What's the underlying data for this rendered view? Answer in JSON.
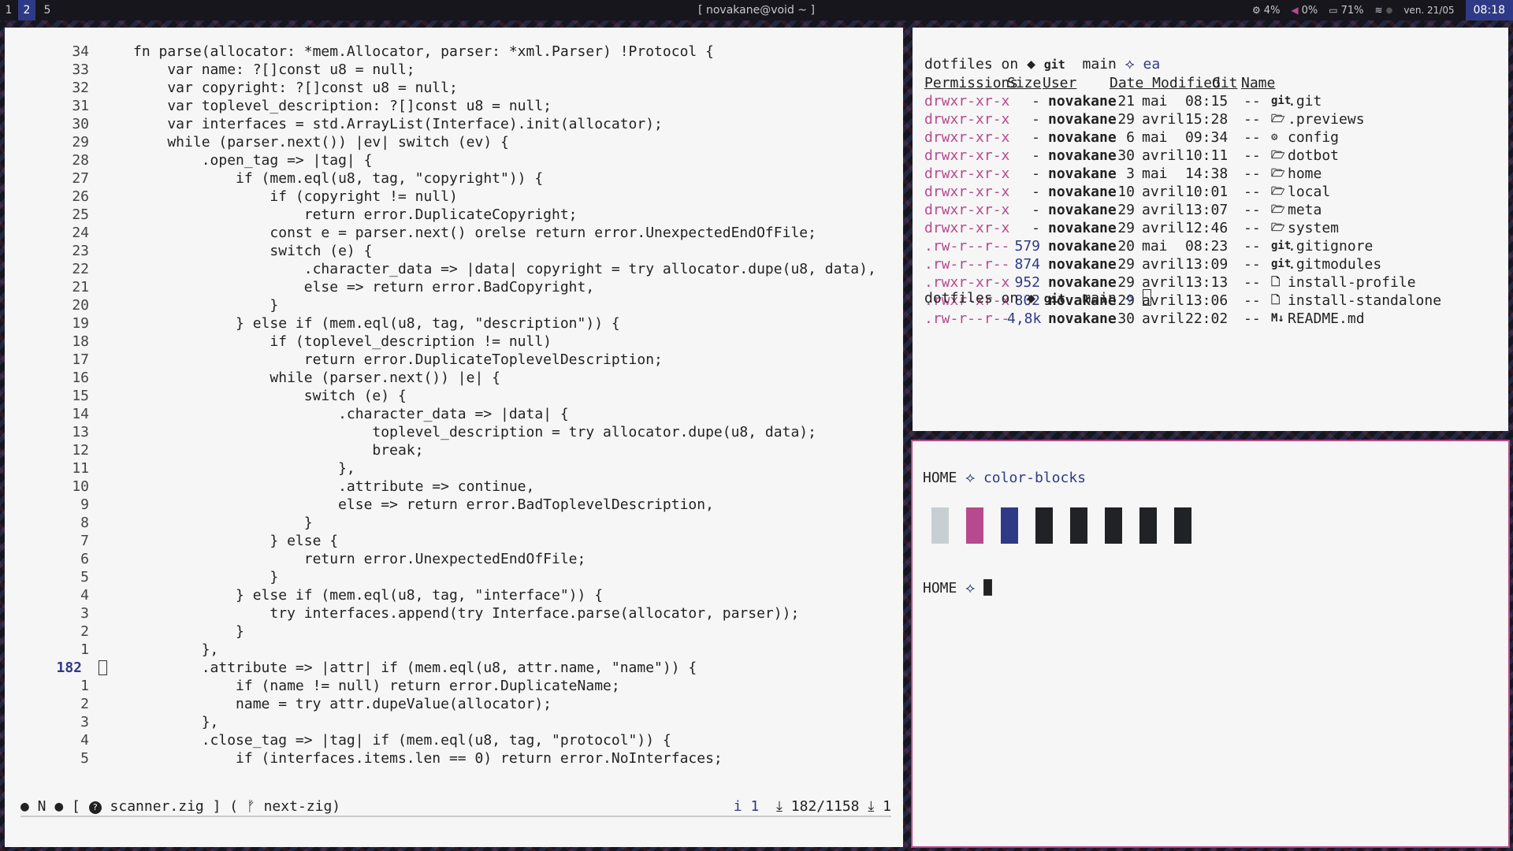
{
  "topbar": {
    "workspaces": [
      "1",
      "2",
      "5"
    ],
    "active_workspace": "2",
    "window_title": "[ novakane@void ~ ]",
    "cpu": "4%",
    "volume": "0%",
    "battery": "71%",
    "date": "ven. 21/05",
    "time": "08:18",
    "icons": [
      "cpu-icon",
      "volume-muted-icon",
      "battery-icon",
      "wifi-icon"
    ]
  },
  "editor": {
    "lines": [
      {
        "n": "34",
        "text": "fn parse(allocator: *mem.Allocator, parser: *xml.Parser) !Protocol {"
      },
      {
        "n": "33",
        "text": "    var name: ?[]const u8 = null;"
      },
      {
        "n": "32",
        "text": "    var copyright: ?[]const u8 = null;"
      },
      {
        "n": "31",
        "text": "    var toplevel_description: ?[]const u8 = null;"
      },
      {
        "n": "30",
        "text": "    var interfaces = std.ArrayList(Interface).init(allocator);"
      },
      {
        "n": "29",
        "text": "    while (parser.next()) |ev| switch (ev) {"
      },
      {
        "n": "28",
        "text": "        .open_tag => |tag| {"
      },
      {
        "n": "27",
        "text": "            if (mem.eql(u8, tag, \"copyright\")) {"
      },
      {
        "n": "26",
        "text": "                if (copyright != null)"
      },
      {
        "n": "25",
        "text": "                    return error.DuplicateCopyright;"
      },
      {
        "n": "24",
        "text": "                const e = parser.next() orelse return error.UnexpectedEndOfFile;"
      },
      {
        "n": "23",
        "text": "                switch (e) {"
      },
      {
        "n": "22",
        "text": "                    .character_data => |data| copyright = try allocator.dupe(u8, data),"
      },
      {
        "n": "21",
        "text": "                    else => return error.BadCopyright,"
      },
      {
        "n": "20",
        "text": "                }"
      },
      {
        "n": "19",
        "text": "            } else if (mem.eql(u8, tag, \"description\")) {"
      },
      {
        "n": "18",
        "text": "                if (toplevel_description != null)"
      },
      {
        "n": "17",
        "text": "                    return error.DuplicateToplevelDescription;"
      },
      {
        "n": "16",
        "text": "                while (parser.next()) |e| {"
      },
      {
        "n": "15",
        "text": "                    switch (e) {"
      },
      {
        "n": "14",
        "text": "                        .character_data => |data| {"
      },
      {
        "n": "13",
        "text": "                            toplevel_description = try allocator.dupe(u8, data);"
      },
      {
        "n": "12",
        "text": "                            break;"
      },
      {
        "n": "11",
        "text": "                        },"
      },
      {
        "n": "10",
        "text": "                        .attribute => continue,"
      },
      {
        "n": "9",
        "text": "                        else => return error.BadToplevelDescription,"
      },
      {
        "n": "8",
        "text": "                    }"
      },
      {
        "n": "7",
        "text": "                } else {"
      },
      {
        "n": "6",
        "text": "                    return error.UnexpectedEndOfFile;"
      },
      {
        "n": "5",
        "text": "                }"
      },
      {
        "n": "4",
        "text": "            } else if (mem.eql(u8, tag, \"interface\")) {"
      },
      {
        "n": "3",
        "text": "                try interfaces.append(try Interface.parse(allocator, parser));"
      },
      {
        "n": "2",
        "text": "            }"
      },
      {
        "n": "1",
        "text": "        },"
      },
      {
        "n": "182",
        "text": "        .attribute => |attr| if (mem.eql(u8, attr.name, \"name\")) {",
        "current": true
      },
      {
        "n": "1",
        "text": "            if (name != null) return error.DuplicateName;"
      },
      {
        "n": "2",
        "text": "            name = try attr.dupeValue(allocator);"
      },
      {
        "n": "3",
        "text": "        },"
      },
      {
        "n": "4",
        "text": "        .close_tag => |tag| if (mem.eql(u8, tag, \"protocol\")) {"
      },
      {
        "n": "5",
        "text": "            if (interfaces.items.len == 0) return error.NoInterfaces;"
      }
    ],
    "statusline": {
      "left": "● N ● [ ",
      "file": "scanner.zig ] ( ",
      "branch_icon": "ᚠ",
      "branch": "next-zig)",
      "info_icon": "i",
      "info_count": "1",
      "position": "182/1158",
      "col": "1"
    }
  },
  "files": {
    "prompt1": {
      "dir": "dotfiles",
      "on": " on ",
      "git_label": "git",
      "branch": "main",
      "extra": "ea"
    },
    "headers": [
      "Permissions",
      "Size",
      "User",
      "Date Modified",
      "Git",
      "Name"
    ],
    "rows": [
      {
        "perm": "drwxr-xr-x",
        "size": "-",
        "user": "novakane",
        "day": "21",
        "month": "mai",
        "time": "08:15",
        "git": "--",
        "icon": "git",
        "name": ".git"
      },
      {
        "perm": "drwxr-xr-x",
        "size": "-",
        "user": "novakane",
        "day": "29",
        "month": "avril",
        "time": "15:28",
        "git": "--",
        "icon": "folder",
        "name": ".previews"
      },
      {
        "perm": "drwxr-xr-x",
        "size": "-",
        "user": "novakane",
        "day": "6",
        "month": "mai",
        "time": "09:34",
        "git": "--",
        "icon": "config",
        "name": "config"
      },
      {
        "perm": "drwxr-xr-x",
        "size": "-",
        "user": "novakane",
        "day": "30",
        "month": "avril",
        "time": "10:11",
        "git": "--",
        "icon": "folder",
        "name": "dotbot"
      },
      {
        "perm": "drwxr-xr-x",
        "size": "-",
        "user": "novakane",
        "day": "3",
        "month": "mai",
        "time": "14:38",
        "git": "--",
        "icon": "folder",
        "name": "home"
      },
      {
        "perm": "drwxr-xr-x",
        "size": "-",
        "user": "novakane",
        "day": "10",
        "month": "avril",
        "time": "10:01",
        "git": "--",
        "icon": "folder",
        "name": "local"
      },
      {
        "perm": "drwxr-xr-x",
        "size": "-",
        "user": "novakane",
        "day": "29",
        "month": "avril",
        "time": "13:07",
        "git": "--",
        "icon": "folder",
        "name": "meta"
      },
      {
        "perm": "drwxr-xr-x",
        "size": "-",
        "user": "novakane",
        "day": "29",
        "month": "avril",
        "time": "12:46",
        "git": "--",
        "icon": "folder",
        "name": "system"
      },
      {
        "perm": ".rw-r--r--",
        "size": "579",
        "user": "novakane",
        "day": "20",
        "month": "mai",
        "time": "08:23",
        "git": "--",
        "icon": "git",
        "name": ".gitignore"
      },
      {
        "perm": ".rw-r--r--",
        "size": "874",
        "user": "novakane",
        "day": "29",
        "month": "avril",
        "time": "13:09",
        "git": "--",
        "icon": "git",
        "name": ".gitmodules"
      },
      {
        "perm": ".rwxr-xr-x",
        "size": "952",
        "user": "novakane",
        "day": "29",
        "month": "avril",
        "time": "13:13",
        "git": "--",
        "icon": "file",
        "name": "install-profile"
      },
      {
        "perm": ".rwxr-xr-x",
        "size": "802",
        "user": "novakane",
        "day": "29",
        "month": "avril",
        "time": "13:06",
        "git": "--",
        "icon": "file",
        "name": "install-standalone"
      },
      {
        "perm": ".rw-r--r--",
        "size": "4,8k",
        "user": "novakane",
        "day": "30",
        "month": "avril",
        "time": "22:02",
        "git": "--",
        "icon": "markdown",
        "name": "README.md"
      }
    ],
    "prompt2": {
      "dir": "dotfiles",
      "on": " on ",
      "git_label": "git",
      "branch": "main"
    }
  },
  "blocks": {
    "prompt1": {
      "dir": "HOME",
      "command": "color-blocks"
    },
    "colors": [
      "#c8cfd3",
      "#b74a8e",
      "#2f3a86",
      "#202225",
      "#202225",
      "#202225",
      "#202225",
      "#202225"
    ],
    "prompt2": {
      "dir": "HOME"
    }
  },
  "colors": {
    "accent_blue": "#2f3a86",
    "accent_purple": "#b74a8e",
    "fg": "#222222",
    "bg": "#f6f6f6"
  }
}
